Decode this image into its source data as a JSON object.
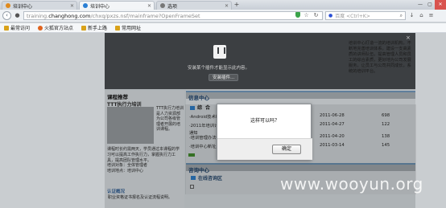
{
  "browser": {
    "tabs": [
      {
        "label": "培训中心",
        "icon_color": "#e08a1e",
        "active": false
      },
      {
        "label": "培训中心",
        "icon_color": "#2a7fd4",
        "active": true
      },
      {
        "label": "选项",
        "icon_color": "#777777",
        "active": false
      }
    ],
    "new_tab": "+",
    "window_controls": [
      "—",
      "▢",
      "✕"
    ],
    "url_prefix": "training.",
    "url_host": "changhong.com",
    "url_path": "/chxq/pxzs.nsf/mainframe?OpenFrameSet",
    "search_placeholder": "百度 <Ctrl+K>",
    "bookmarks": [
      {
        "label": "最常访问",
        "icon_color": "#d9a21a"
      },
      {
        "label": "火狐官方站点",
        "icon_color": "#e0631e"
      },
      {
        "label": "新手上路",
        "icon_color": "#d9a21a"
      },
      {
        "label": "常用网址",
        "icon_color": "#d9a21a"
      }
    ]
  },
  "plugin_bar": {
    "message": "安装某个插件才能显示此内容。",
    "button": "安装插件...",
    "close": "×"
  },
  "intro_text": "培训中心打造一流的培训机构，不断地完善培训体系，建设一支高素质的讲师队伍，提高管理人员和员工的综合素质，更好地为公司发展服务，让员工与公司共同成长，系统的培训平台。",
  "left": {
    "title": "课程推荐",
    "subtitle": "TTT执行力培训",
    "side_text": "TTT执行力培训是人力资源部为公司各级管理者开展的培训课程。",
    "desc": "课程时长约需两天，学员通过本课程的学习可以提高工作执行力，掌握执行力工具，提高团队管理水平。",
    "meta1": "培训对象：全体管理者",
    "meta2": "培训地点：培训中心",
    "box_title": "认证概况",
    "box_text": "职业资格证书报名及认证流程说明。"
  },
  "news": {
    "header": "信息中心",
    "tabs": [
      "综",
      "合"
    ],
    "rows": [
      {
        "title": "·Android技术培训班开班通知",
        "date": "2011-06-28",
        "count": "698"
      },
      {
        "title": "·2011年培训计划调整通知",
        "date": "2011-04-27",
        "count": "122"
      },
      {
        "title": "·培训管理办法修订",
        "date": "2011-04-20",
        "count": "138"
      },
      {
        "title": "·培训中心新址启用通知",
        "date": "2011-03-14",
        "count": "145"
      }
    ],
    "note": "通知"
  },
  "consult": {
    "header": "咨询中心",
    "item": "在线咨询区"
  },
  "dialog": {
    "message": "这样可以吗？",
    "ok": "确定"
  },
  "watermark": "www.wooyun.org"
}
